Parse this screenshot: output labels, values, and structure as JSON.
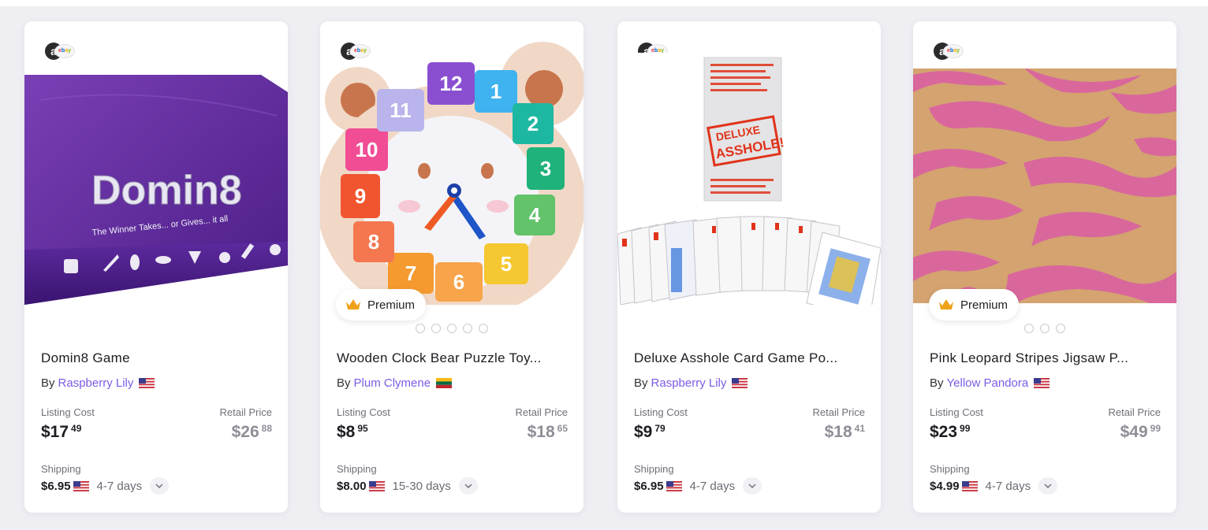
{
  "common": {
    "by_label": "By",
    "listing_cost_label": "Listing Cost",
    "retail_price_label": "Retail Price",
    "shipping_label": "Shipping",
    "premium_label": "Premium",
    "source_logo_letter": "a",
    "source_logo_ebay": "ebay"
  },
  "colors": {
    "seller_link": "#7b5be6",
    "retail_price": "#8e8e98",
    "premium_crown": "#f0a11b"
  },
  "products": [
    {
      "title": "Domin8 Game",
      "seller": "Raspberry Lily",
      "flag": "us-flag",
      "listing_cost": {
        "main": "$17",
        "cents": "49"
      },
      "retail_price": {
        "main": "$26",
        "cents": "88"
      },
      "shipping_cost": "$6.95",
      "shipping_days": "4-7 days",
      "premium": false,
      "image_dots": 0,
      "image_text": {
        "brand": "Domin8",
        "tagline": "The Winner Takes... or Gives... it all"
      }
    },
    {
      "title": "Wooden Clock Bear Puzzle Toy...",
      "seller": "Plum Clymene",
      "flag": "lt-flag",
      "listing_cost": {
        "main": "$8",
        "cents": "95"
      },
      "retail_price": {
        "main": "$18",
        "cents": "65"
      },
      "shipping_cost": "$8.00",
      "shipping_days": "15-30 days",
      "premium": true,
      "image_dots": 5,
      "image_text": {
        "clock_numbers": [
          "12",
          "1",
          "2",
          "3",
          "4",
          "5",
          "6",
          "7",
          "8",
          "9",
          "10",
          "11"
        ]
      }
    },
    {
      "title": "Deluxe Asshole Card Game Po...",
      "seller": "Raspberry Lily",
      "flag": "us-flag",
      "listing_cost": {
        "main": "$9",
        "cents": "79"
      },
      "retail_price": {
        "main": "$18",
        "cents": "41"
      },
      "shipping_cost": "$6.95",
      "shipping_days": "4-7 days",
      "premium": false,
      "image_dots": 0,
      "image_text": {
        "stamp_line1": "DELUXE",
        "stamp_line2": "ASSHOLE!"
      }
    },
    {
      "title": "Pink Leopard Stripes Jigsaw P...",
      "seller": "Yellow Pandora",
      "flag": "us-flag",
      "listing_cost": {
        "main": "$23",
        "cents": "99"
      },
      "retail_price": {
        "main": "$49",
        "cents": "99"
      },
      "shipping_cost": "$4.99",
      "shipping_days": "4-7 days",
      "premium": true,
      "image_dots": 3,
      "image_text": {}
    }
  ]
}
